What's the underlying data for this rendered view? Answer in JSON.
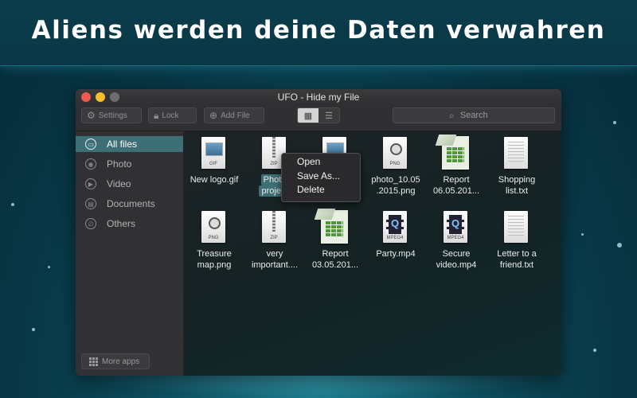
{
  "headline": "Aliens werden deine Daten verwahren",
  "window": {
    "title": "UFO - Hide my File"
  },
  "toolbar": {
    "settings_label": "Settings",
    "lock_label": "Lock",
    "add_file_label": "Add File",
    "search_placeholder": "Search",
    "active_view": "grid"
  },
  "sidebar": {
    "items": [
      {
        "label": "All files",
        "icon": "folder-icon",
        "active": true
      },
      {
        "label": "Photo",
        "icon": "camera-icon",
        "active": false
      },
      {
        "label": "Video",
        "icon": "video-camera-icon",
        "active": false
      },
      {
        "label": "Documents",
        "icon": "document-icon",
        "active": false
      },
      {
        "label": "Others",
        "icon": "paperclip-icon",
        "active": false
      }
    ],
    "more_apps_label": "More apps"
  },
  "files": [
    {
      "line1": "New logo.gif",
      "line2": "",
      "ext": "GIF",
      "kind": "image"
    },
    {
      "line1": "Photo",
      "line2": "project",
      "ext": "ZIP",
      "kind": "zip",
      "selected": true
    },
    {
      "line1": "",
      "line2": "",
      "ext": "",
      "kind": "image"
    },
    {
      "line1": "photo_10.05",
      "line2": ".2015.png",
      "ext": "PNG",
      "kind": "image"
    },
    {
      "line1": "Report",
      "line2": "06.05.201...",
      "ext": "",
      "kind": "sheet"
    },
    {
      "line1": "Shopping",
      "line2": "list.txt",
      "ext": "",
      "kind": "text"
    },
    {
      "line1": "Treasure",
      "line2": "map.png",
      "ext": "PNG",
      "kind": "image"
    },
    {
      "line1": "very",
      "line2": "important....",
      "ext": "ZIP",
      "kind": "zip"
    },
    {
      "line1": "Report",
      "line2": "03.05.201...",
      "ext": "",
      "kind": "sheet"
    },
    {
      "line1": "Party.mp4",
      "line2": "",
      "ext": "MPEG4",
      "kind": "video"
    },
    {
      "line1": "Secure",
      "line2": "video.mp4",
      "ext": "MPEG4",
      "kind": "video"
    },
    {
      "line1": "Letter to a",
      "line2": "friend.txt",
      "ext": "",
      "kind": "text"
    }
  ],
  "context_menu": {
    "items": [
      "Open",
      "Save As...",
      "Delete"
    ]
  },
  "colors": {
    "accent": "#3f6f76",
    "close": "#ee5a52",
    "minimize": "#f5bf2e"
  }
}
